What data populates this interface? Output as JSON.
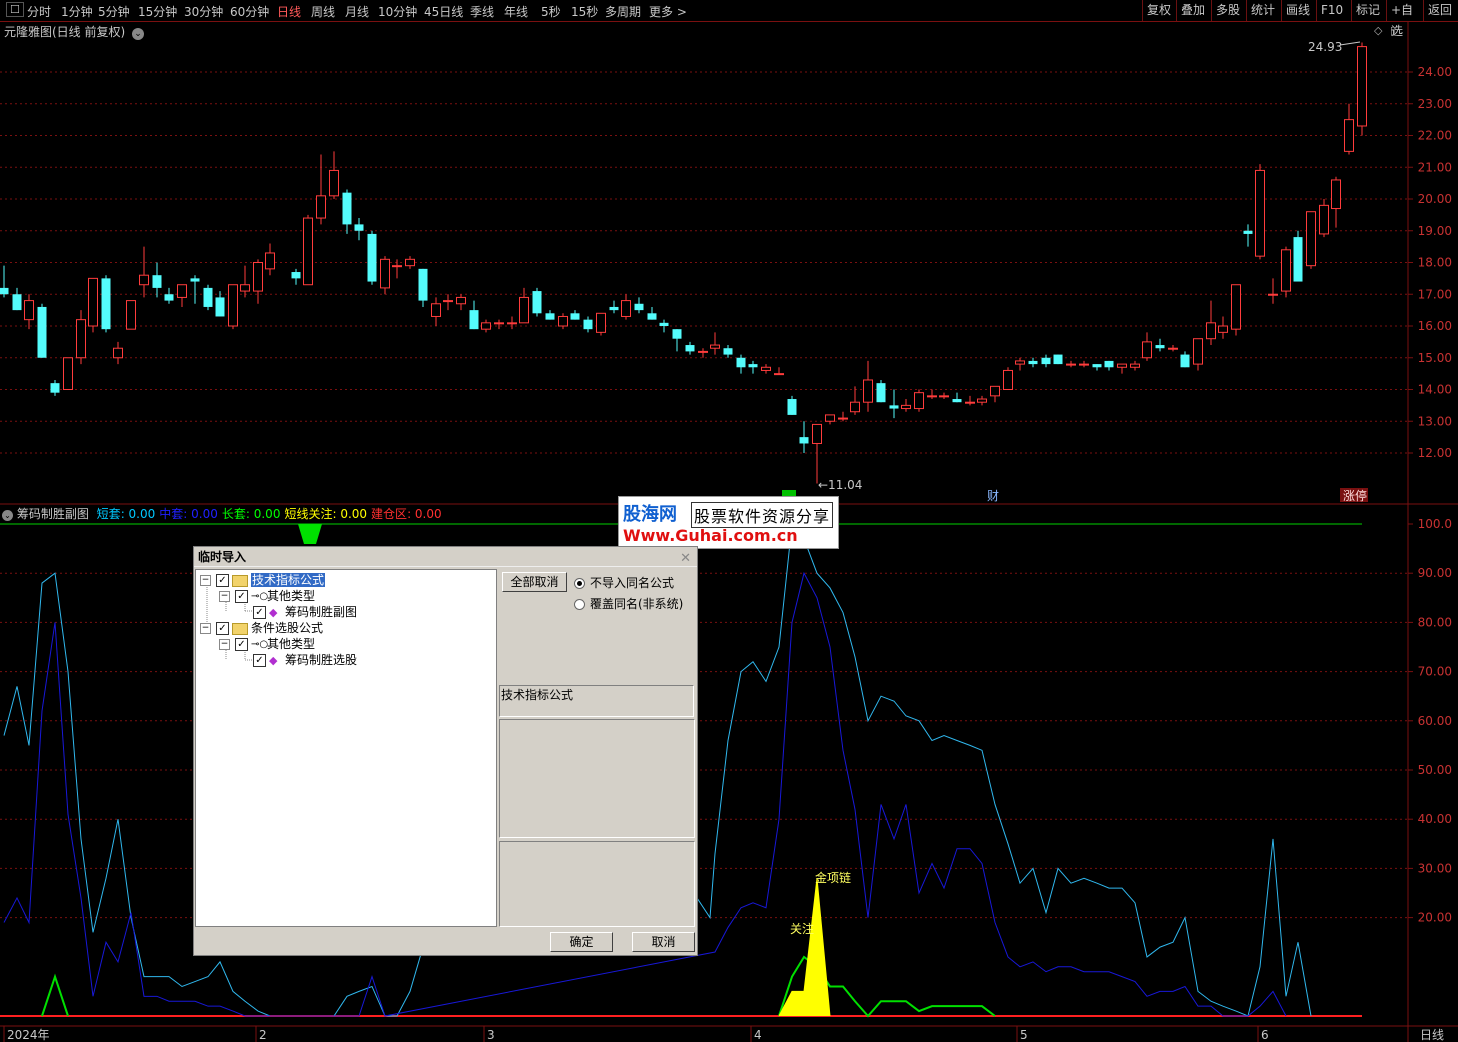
{
  "toolbar": {
    "menu_icon": "menu-icon",
    "periods": [
      "分时",
      "1分钟",
      "5分钟",
      "15分钟",
      "30分钟",
      "60分钟",
      "日线",
      "周线",
      "月线",
      "10分钟",
      "45日线",
      "季线",
      "年线",
      "5秒",
      "15秒",
      "多周期",
      "更多 >"
    ],
    "active_period": "日线",
    "right_tools": [
      "复权",
      "叠加",
      "多股",
      "统计",
      "画线",
      "F10",
      "标记",
      "+自选",
      "返回"
    ]
  },
  "main_chart": {
    "title": "元隆雅图(日线 前复权)",
    "price_axis": [
      "24.00",
      "23.00",
      "22.00",
      "21.00",
      "20.00",
      "19.00",
      "18.00",
      "17.00",
      "16.00",
      "15.00",
      "14.00",
      "13.00",
      "12.00"
    ],
    "high_label": "24.93",
    "low_label": "←11.04",
    "markers": {
      "cai": "财",
      "zhangting": "涨停"
    }
  },
  "sub_chart": {
    "title": "筹码制胜副图",
    "legend": [
      {
        "name": "短套",
        "value": "0.00",
        "color": "#00c8ff"
      },
      {
        "name": "中套",
        "value": "0.00",
        "color": "#2020ff"
      },
      {
        "name": "长套",
        "value": "0.00",
        "color": "#00ff00"
      },
      {
        "name": "短线关注",
        "value": "0.00",
        "color": "#ffff00"
      },
      {
        "name": "建仓区",
        "value": "0.00",
        "color": "#ff3030"
      }
    ],
    "axis": [
      "100.0",
      "90.00",
      "80.00",
      "70.00",
      "60.00",
      "50.00",
      "40.00",
      "30.00",
      "20.00"
    ],
    "annotations": {
      "jinxiang": "金项链",
      "guanzhu": "关注"
    }
  },
  "time_axis": {
    "labels": [
      "2024年",
      "2",
      "3",
      "4",
      "5",
      "6"
    ],
    "period": "日线"
  },
  "watermark": {
    "brand": "股海网",
    "slogan": "股票软件资源分享",
    "url": "Www.Guhai.com.cn"
  },
  "dialog": {
    "title": "临时导入",
    "tree": [
      {
        "label": "技术指标公式",
        "level": 0,
        "type": "folder",
        "selected": true
      },
      {
        "label": "其他类型",
        "level": 1,
        "type": "key"
      },
      {
        "label": "筹码制胜副图",
        "level": 2,
        "type": "item"
      },
      {
        "label": "条件选股公式",
        "level": 0,
        "type": "folder"
      },
      {
        "label": "其他类型",
        "level": 1,
        "type": "key"
      },
      {
        "label": "筹码制胜选股",
        "level": 2,
        "type": "item"
      }
    ],
    "cancel_all": "全部取消",
    "options": [
      {
        "label": "不导入同名公式",
        "checked": true
      },
      {
        "label": "覆盖同名(非系统)",
        "checked": false
      }
    ],
    "info_label": "技术指标公式",
    "ok": "确定",
    "cancel": "取消"
  },
  "colors": {
    "up": "#ff3c3c",
    "down": "#54fcfc",
    "grid": "#7a1010",
    "axis_text": "#c83232"
  }
}
